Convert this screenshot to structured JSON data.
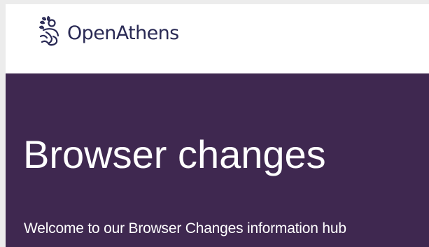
{
  "header": {
    "logo_text": "OpenAthens"
  },
  "hero": {
    "title": "Browser changes",
    "intro": "Welcome to our Browser Changes information hub"
  },
  "colors": {
    "hero_background": "#3f2850",
    "logo_text": "#2a2a55",
    "logo_icon": "#2a2a55"
  },
  "icons": {
    "logo": "openathens-laurel-figure-icon"
  }
}
